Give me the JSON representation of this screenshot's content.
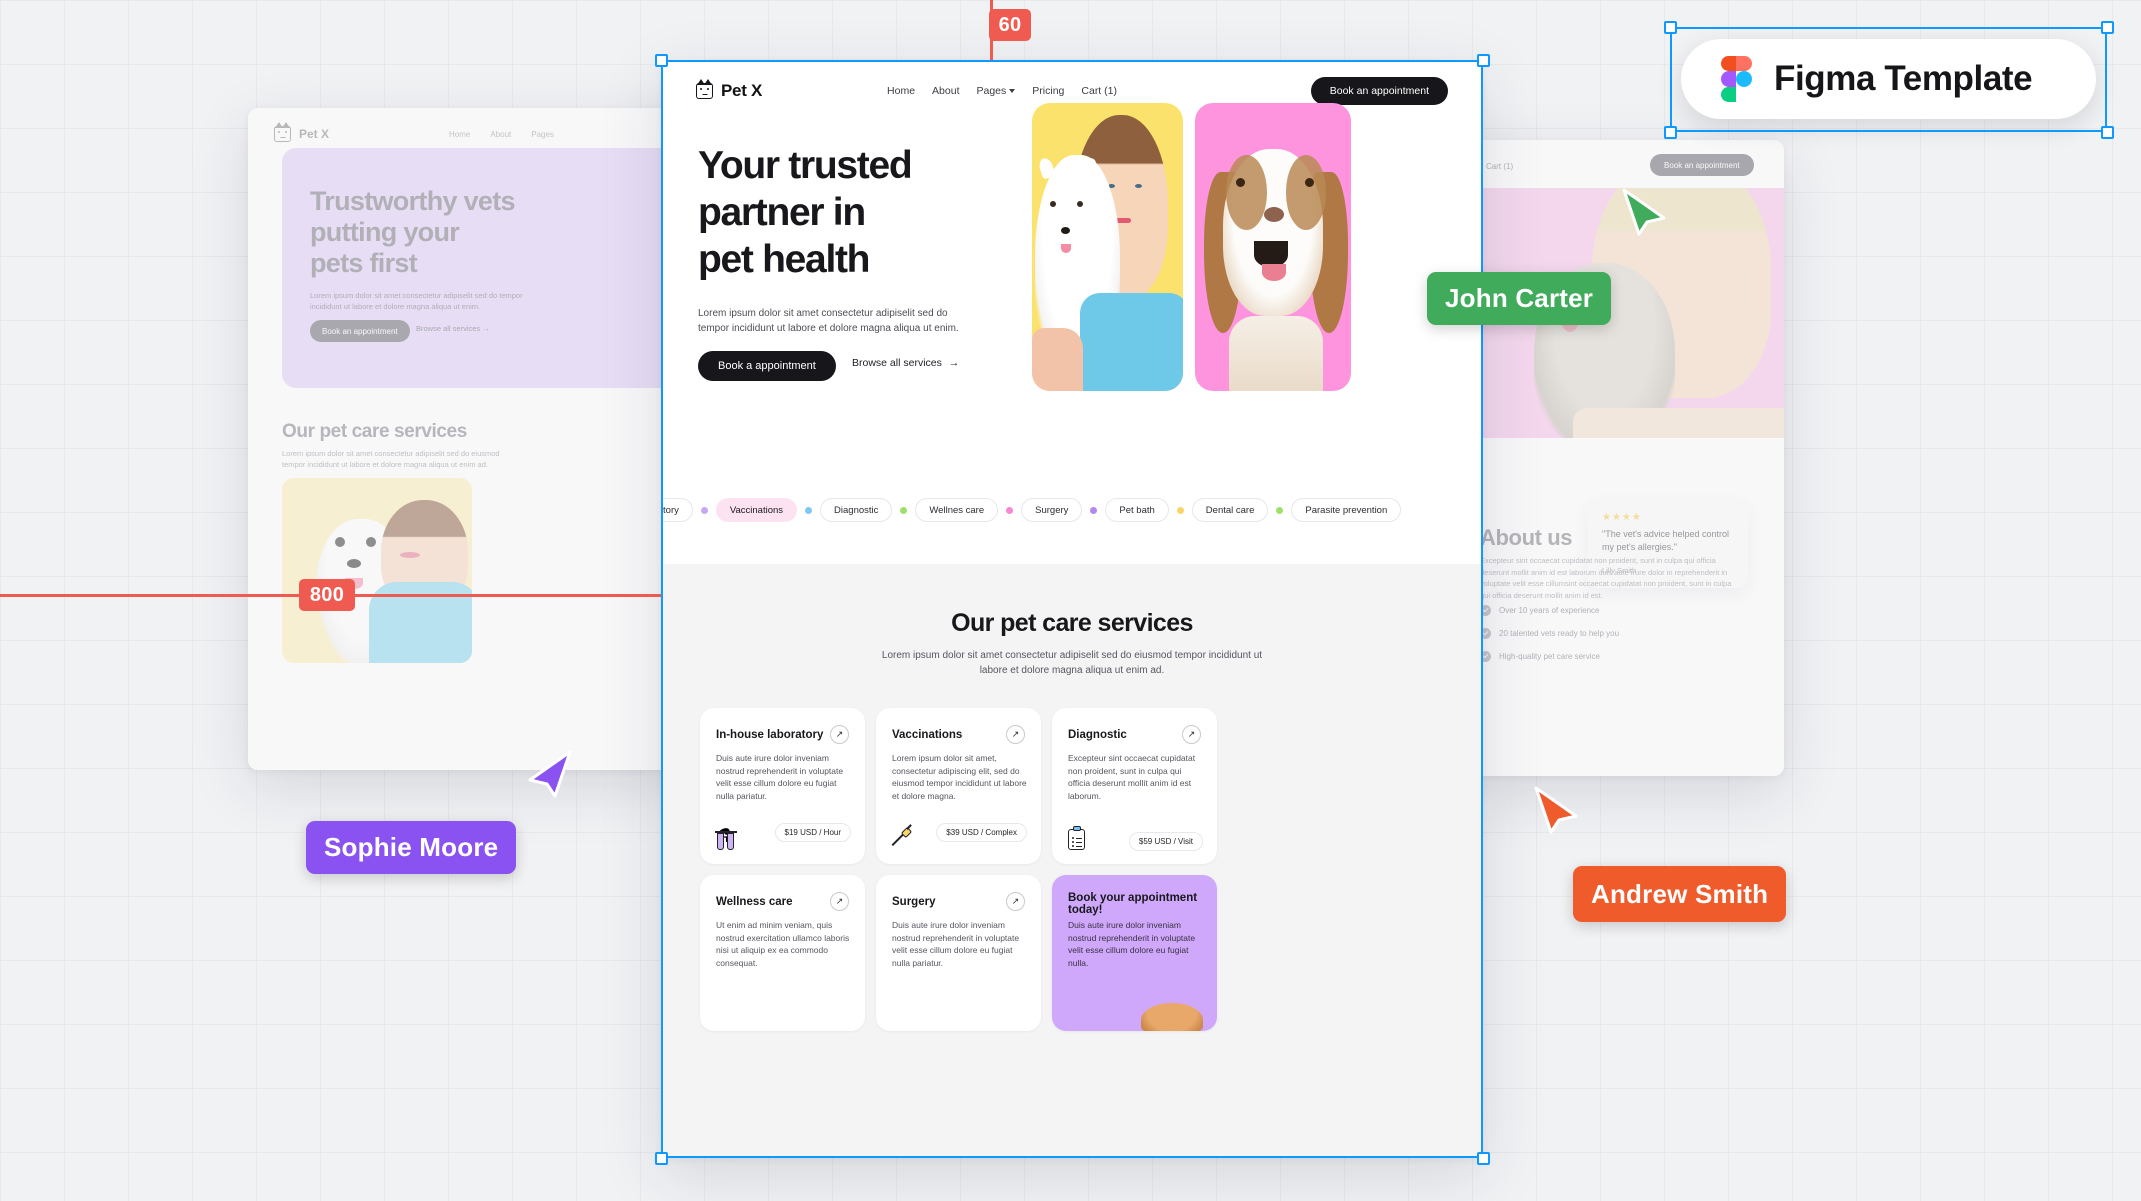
{
  "canvas": {
    "background_color": "#f1f2f4",
    "selection_color": "#0d99ff",
    "measure_color": "#ef5b51"
  },
  "measurements": [
    {
      "value": "60",
      "orientation": "vertical"
    },
    {
      "value": "800",
      "orientation": "horizontal"
    }
  ],
  "figma_badge": {
    "label": "Figma Template",
    "icon": "figma-logo",
    "colors": {
      "orange": "#f24e1e",
      "red": "#ff7262",
      "purple": "#a259ff",
      "blue": "#1abcfe",
      "green": "#0acf83"
    }
  },
  "cursors": [
    {
      "name": "Sophie Moore",
      "color": "#8a52f0"
    },
    {
      "name": "John Carter",
      "color": "#3fab5b"
    },
    {
      "name": "Andrew Smith",
      "color": "#ef5b2b"
    }
  ],
  "site": {
    "brand": "Pet X",
    "brand_icon": "cat-logo-icon",
    "nav": [
      {
        "label": "Home",
        "has_chevron": false
      },
      {
        "label": "About",
        "has_chevron": false
      },
      {
        "label": "Pages",
        "has_chevron": true
      },
      {
        "label": "Pricing",
        "has_chevron": false
      },
      {
        "label": "Cart (1)",
        "has_chevron": false
      }
    ],
    "nav_cta": "Book an appointment",
    "hero": {
      "title_lines": [
        "Your trusted",
        "partner in",
        "pet health"
      ],
      "paragraph": "Lorem ipsum dolor sit amet consectetur adipiselit sed do tempor incididunt ut labore et dolore magna aliqua ut enim.",
      "primary_cta": "Book a appointment",
      "secondary_cta": "Browse all services",
      "secondary_cta_icon": "arrow-right-icon",
      "images": [
        {
          "name": "vet-with-white-dog",
          "bg": "#fbe26d"
        },
        {
          "name": "beagle-portrait",
          "bg": "#fd94dd"
        }
      ]
    },
    "service_chips": [
      {
        "label": "In-house laboratory",
        "dot": "#c6a8f5",
        "active": false
      },
      {
        "label": "Vaccinations",
        "dot": "#7ec8f5",
        "active": true
      },
      {
        "label": "Diagnostic",
        "dot": "#9ee06a",
        "active": false
      },
      {
        "label": "Wellnes care",
        "dot": "#fb86d3",
        "active": false
      },
      {
        "label": "Surgery",
        "dot": "#b089f2",
        "active": false
      },
      {
        "label": "Pet bath",
        "dot": "#fbd564",
        "active": false
      },
      {
        "label": "Dental care",
        "dot": "#9ee06a",
        "active": false
      },
      {
        "label": "Parasite prevention",
        "dot": "#8ad2f7",
        "active": false
      }
    ],
    "services_section": {
      "title": "Our pet care services",
      "subtitle": "Lorem ipsum dolor sit amet consectetur adipiselit sed do eiusmod tempor incididunt ut labore et dolore magna aliqua ut enim ad.",
      "cards": [
        {
          "title": "In-house laboratory",
          "body": "Duis aute irure dolor inveniam nostrud reprehenderit in voluptate velit esse cillum dolore eu fugiat nulla pariatur.",
          "price": "$19 USD / Hour",
          "icon": "test-tubes-icon",
          "highlight": false
        },
        {
          "title": "Vaccinations",
          "body": "Lorem ipsum dolor sit amet, consectetur adipiscing elit, sed do eiusmod tempor incididunt ut labore et dolore magna.",
          "price": "$39 USD / Complex",
          "icon": "syringe-icon",
          "highlight": false
        },
        {
          "title": "Diagnostic",
          "body": "Excepteur sint occaecat cupidatat non proident, sunt in culpa qui officia deserunt mollit anim id est laborum.",
          "price": "$59 USD / Visit",
          "icon": "clipboard-icon",
          "highlight": false
        },
        {
          "title": "Wellness care",
          "body": "Ut enim ad minim veniam, quis nostrud exercitation ullamco laboris nisi ut aliquip ex ea commodo consequat.",
          "price": "",
          "icon": "",
          "highlight": false
        },
        {
          "title": "Surgery",
          "body": "Duis aute irure dolor inveniam nostrud reprehenderit in voluptate velit esse cillum dolore eu fugiat nulla pariatur.",
          "price": "",
          "icon": "",
          "highlight": false
        },
        {
          "title": "Book your appointment today!",
          "body": "Duis aute irure dolor inveniam nostrud reprehenderit in voluptate velit esse cillum dolore eu fugiat nulla.",
          "price": "",
          "icon": "",
          "highlight": true,
          "highlight_color": "#cfa8fb"
        }
      ]
    }
  },
  "left_frame": {
    "brand": "Pet X",
    "nav": [
      "Home",
      "About",
      "Pages"
    ],
    "hero": {
      "title_lines": [
        "Trustworthy vets",
        "putting your",
        "pets first"
      ],
      "paragraph": "Lorem ipsum dolor sit amet consectetur adipiselit sed do tempor incididunt ut labore et dolore magna aliqua ut enim.",
      "primary_cta": "Book an appointment",
      "secondary_cta": "Browse all services",
      "bg_color": "#ddc8f7"
    },
    "services_title": "Our pet care services",
    "services_subtitle": "Lorem ipsum dolor sit amet consectetur adipiselit sed do eiusmod tempor incididunt ut labore et dolore magna aliqua ut enim ad.",
    "photo_name": "vet-with-white-dog-photo",
    "photo_bg": "#fbecb0"
  },
  "right_frame": {
    "nav_cart": "Cart (1)",
    "nav_cta": "Book an appointment",
    "hero_photo_name": "woman-with-husky-photo",
    "hero_photo_bg": "#f7bde7",
    "testimonial": {
      "stars": 4,
      "quote": "\"The vet's advice helped control my pet's allergies.\"",
      "author": "Lilly Smith"
    },
    "about": {
      "title": "About us",
      "body": "Excepteur sint occaecat cupidatat non proident, sunt in culpa qui officia deserunt mollit anim id est laborum duis aute irure dolor in reprehenderit in voluptate velit esse cillumsint occaecat cupidatat non proident, sunt in culpa qui officia deserunt mollit anim id est.",
      "bullets": [
        "Over 10 years of experience",
        "20 talented vets ready to help you",
        "High-quality pet care service"
      ]
    }
  }
}
